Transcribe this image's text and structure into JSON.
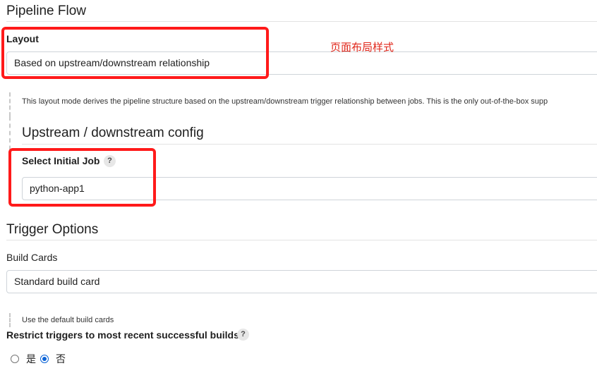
{
  "pipeline_flow": {
    "title": "Pipeline Flow",
    "layout_label": "Layout",
    "layout_value": "Based on upstream/downstream relationship",
    "layout_annotation": "页面布局样式",
    "layout_description": "This layout mode derives the pipeline structure based on the upstream/downstream trigger relationship between jobs. This is the only out-of-the-box supp",
    "upstream_config": {
      "title": "Upstream / downstream config",
      "initial_job_label": "Select Initial Job",
      "initial_job_help": "?",
      "initial_job_value": "python-app1"
    }
  },
  "trigger_options": {
    "title": "Trigger Options",
    "build_cards_label": "Build Cards",
    "build_cards_value": "Standard build card",
    "build_cards_description": "Use the default build cards",
    "restrict_label": "Restrict triggers to most recent successful builds",
    "restrict_help": "?",
    "restrict_options": [
      {
        "label": "是",
        "checked": false
      },
      {
        "label": "否",
        "checked": true
      }
    ]
  },
  "colors": {
    "highlight_frame": "#ff1a1a",
    "annotation_text": "#e0261a",
    "radio_accent": "#0b63d6"
  }
}
